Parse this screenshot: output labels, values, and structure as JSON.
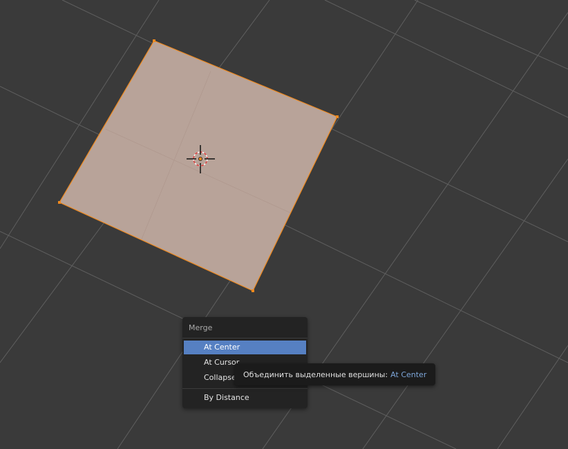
{
  "colors": {
    "viewport_bg": "#3a3a3a",
    "grid_line": "#5f5f5f",
    "face_fill": "#b8a399",
    "selection_orange": "#f08a1f",
    "menu_bg": "#232323",
    "menu_highlight": "#5680c2",
    "tooltip_bg": "#1b1b1b",
    "tooltip_value": "#7da6d9"
  },
  "scene": {
    "mesh": "plane",
    "mode": "edit",
    "selected_vertices": 4,
    "icons": [
      "3d-cursor-icon",
      "object-origin-icon"
    ]
  },
  "merge_menu": {
    "title": "Merge",
    "items": [
      {
        "label": "At Center",
        "active": true
      },
      {
        "label": "At Cursor",
        "active": false
      },
      {
        "label": "Collapse",
        "active": false
      },
      {
        "label": "By Distance",
        "active": false
      }
    ]
  },
  "tooltip": {
    "description": "Объединить выделенные вершины:",
    "value": "At Center"
  }
}
